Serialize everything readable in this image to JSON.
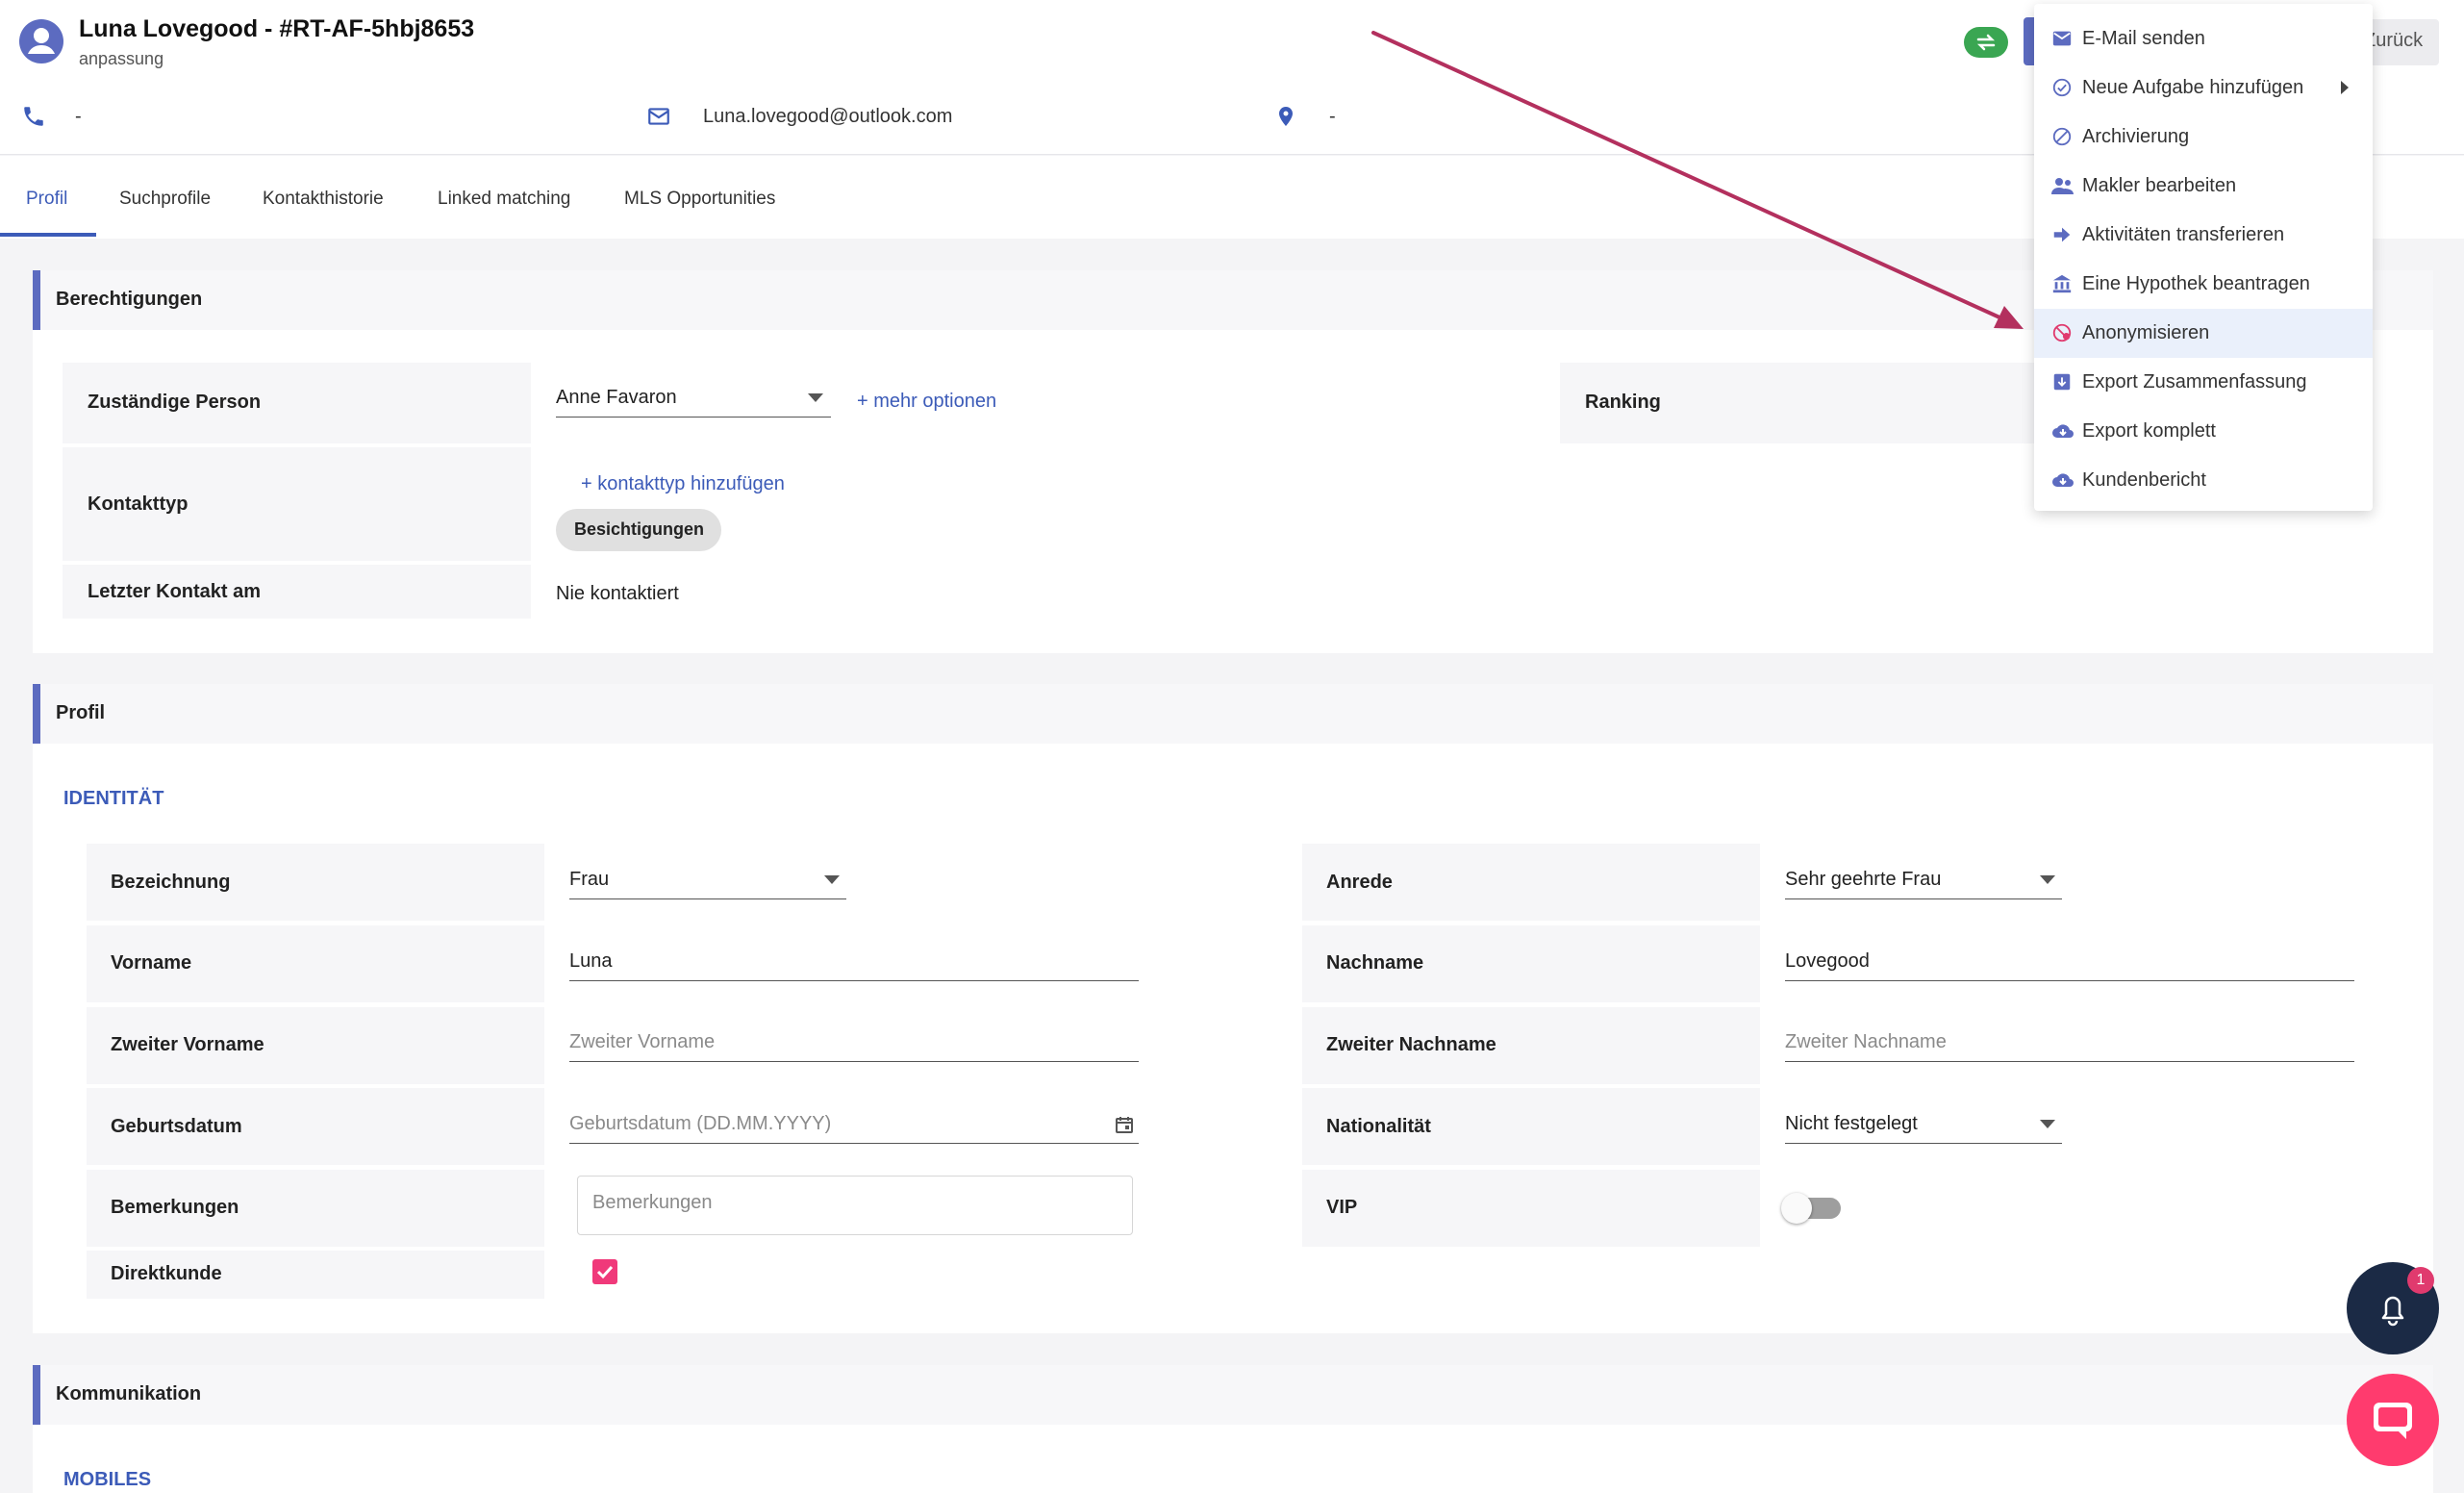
{
  "header": {
    "title": "Luna Lovegood - #RT-AF-5hbj8653",
    "subtitle": "anpassung",
    "back_label": "Zurück",
    "contacts": {
      "phone": "-",
      "email": "Luna.lovegood@outlook.com",
      "address": "-"
    }
  },
  "tabs": [
    {
      "label": "Profil"
    },
    {
      "label": "Suchprofile"
    },
    {
      "label": "Kontakthistorie"
    },
    {
      "label": "Linked matching"
    },
    {
      "label": "MLS Opportunities"
    }
  ],
  "permissions": {
    "title": "Berechtigungen",
    "responsible_label": "Zuständige Person",
    "responsible_value": "Anne Favaron",
    "more_options": "mehr optionen",
    "ranking_label": "Ranking",
    "contact_type_label": "Kontakttyp",
    "add_contact_type": "kontakttyp hinzufügen",
    "contact_type_chip": "Besichtigungen",
    "last_contact_label": "Letzter Kontakt am",
    "last_contact_value": "Nie kontaktiert"
  },
  "profile": {
    "title": "Profil",
    "identity_title": "IDENTITÄT",
    "designation_label": "Bezeichnung",
    "designation_value": "Frau",
    "salutation_label": "Anrede",
    "salutation_value": "Sehr geehrte Frau",
    "firstname_label": "Vorname",
    "firstname_value": "Luna",
    "lastname_label": "Nachname",
    "lastname_value": "Lovegood",
    "second_firstname_label": "Zweiter Vorname",
    "second_firstname_placeholder": "Zweiter Vorname",
    "second_lastname_label": "Zweiter Nachname",
    "second_lastname_placeholder": "Zweiter Nachname",
    "birthdate_label": "Geburtsdatum",
    "birthdate_placeholder": "Geburtsdatum (DD.MM.YYYY)",
    "nationality_label": "Nationalität",
    "nationality_value": "Nicht festgelegt",
    "remarks_label": "Bemerkungen",
    "remarks_placeholder": "Bemerkungen",
    "vip_label": "VIP",
    "vip_on": false,
    "direct_customer_label": "Direktkunde",
    "direct_customer_checked": true
  },
  "communication": {
    "title": "Kommunikation",
    "mobiles_title": "MOBILES"
  },
  "menu": {
    "items": [
      {
        "label": "E-Mail senden",
        "icon": "mail-icon"
      },
      {
        "label": "Neue Aufgabe hinzufügen",
        "icon": "check-circle-icon"
      },
      {
        "label": "Archivierung",
        "icon": "block-icon"
      },
      {
        "label": "Makler bearbeiten",
        "icon": "people-icon"
      },
      {
        "label": "Aktivitäten transferieren",
        "icon": "arrow-right-icon"
      },
      {
        "label": "Eine Hypothek beantragen",
        "icon": "bank-icon"
      },
      {
        "label": "Anonymisieren",
        "icon": "anonymize-icon"
      },
      {
        "label": "Export Zusammenfassung",
        "icon": "download-box-icon"
      },
      {
        "label": "Export komplett",
        "icon": "cloud-download-icon"
      },
      {
        "label": "Kundenbericht",
        "icon": "cloud-download-icon"
      }
    ]
  },
  "notifications": {
    "badge": "1"
  },
  "colors": {
    "primary": "#5c6bc0",
    "link": "#3c5bb8",
    "success": "#3aa652",
    "accent": "#e03a6e",
    "annotation": "#b3305e"
  }
}
